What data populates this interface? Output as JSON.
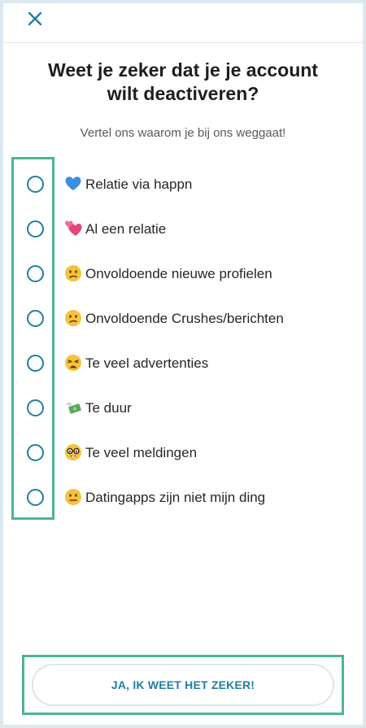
{
  "header": {
    "close_icon": "close-icon"
  },
  "dialog": {
    "title_line1": "Weet je zeker dat je je account",
    "title_line2": "wilt deactiveren?",
    "subtitle": "Vertel ons waarom je bij ons weggaat!"
  },
  "reasons": [
    {
      "label": "Relatie via happn",
      "icon": "blue-heart-icon",
      "selected": false
    },
    {
      "label": "Al een relatie",
      "icon": "two-hearts-icon",
      "selected": false
    },
    {
      "label": "Onvoldoende nieuwe profielen",
      "icon": "confused-face-icon",
      "selected": false
    },
    {
      "label": "Onvoldoende Crushes/berichten",
      "icon": "confused-face-icon",
      "selected": false
    },
    {
      "label": "Te veel advertenties",
      "icon": "weary-face-icon",
      "selected": false
    },
    {
      "label": "Te duur",
      "icon": "money-with-wings-icon",
      "selected": false
    },
    {
      "label": "Te veel meldingen",
      "icon": "nerd-face-icon",
      "selected": false
    },
    {
      "label": "Datingapps zijn niet mijn ding",
      "icon": "neutral-face-icon",
      "selected": false
    }
  ],
  "actions": {
    "confirm_label": "JA, IK WEET HET ZEKER!"
  },
  "colors": {
    "accent": "#1f7fa0",
    "highlight": "#4db494",
    "background": "#dbe8ef"
  }
}
